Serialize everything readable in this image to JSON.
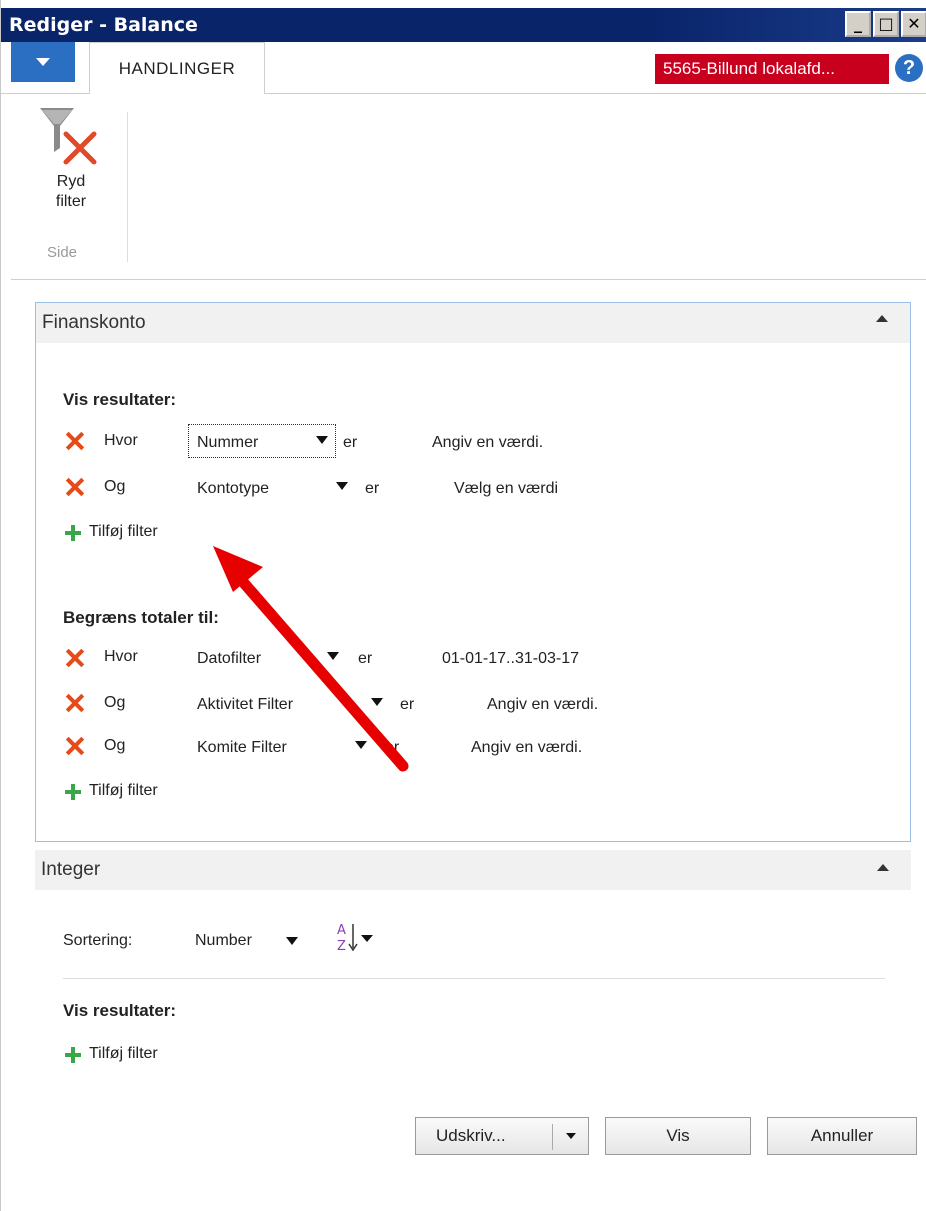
{
  "window": {
    "title": "Rediger - Balance",
    "controls": {
      "minimize": "_",
      "maximize": "□",
      "close": "✕"
    }
  },
  "ribbon": {
    "tab": "HANDLINGER",
    "company": "5565-Billund lokalafd...",
    "help": "?",
    "button_ryd_line1": "Ryd",
    "button_ryd_line2": "filter",
    "group_label": "Side"
  },
  "finanskonto": {
    "header": "Finanskonto",
    "vis_title": "Vis resultater:",
    "vis_filters": [
      {
        "conj": "Hvor",
        "field": "Nummer",
        "op": "er",
        "value": "Angiv en værdi."
      },
      {
        "conj": "Og",
        "field": "Kontotype",
        "op": "er",
        "value": "Vælg en værdi"
      }
    ],
    "add_filter_1": "Tilføj filter",
    "limit_title": "Begræns totaler til:",
    "limit_filters": [
      {
        "conj": "Hvor",
        "field": "Datofilter",
        "op": "er",
        "value": "01-01-17..31-03-17"
      },
      {
        "conj": "Og",
        "field": "Aktivitet Filter",
        "op": "er",
        "value": "Angiv en værdi."
      },
      {
        "conj": "Og",
        "field": "Komite Filter",
        "op": "er",
        "value": "Angiv en værdi."
      }
    ],
    "add_filter_2": "Tilføj filter"
  },
  "integer": {
    "header": "Integer",
    "sort_label": "Sortering:",
    "sort_value": "Number",
    "vis_title": "Vis resultater:",
    "add_filter": "Tilføj filter"
  },
  "buttons": {
    "print": "Udskriv...",
    "show": "Vis",
    "cancel": "Annuller"
  },
  "colors": {
    "title_bar": "#0a246a",
    "accent_blue": "#2b6fc2",
    "company_red": "#c8001e",
    "remove_x": "#e64a19",
    "add_plus": "#3aa64a",
    "annotation_arrow": "#e60000"
  }
}
